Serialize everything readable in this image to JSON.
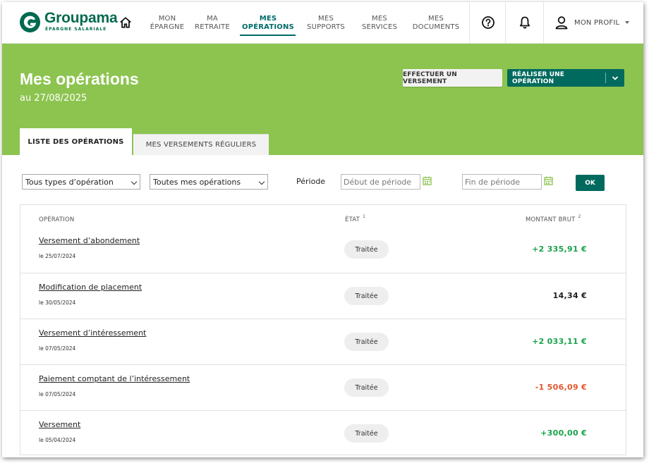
{
  "brand": {
    "name": "Groupama",
    "tagline": "ÉPARGNE SALARIALE",
    "primary_color": "#006a4e",
    "banner_color": "#8cc44f",
    "button_color": "#006a5e",
    "positive_color": "#1aa34a",
    "negative_color": "#e2572b"
  },
  "nav": {
    "items": [
      {
        "line1": "MON",
        "line2": "ÉPARGNE",
        "active": false
      },
      {
        "line1": "MA",
        "line2": "RETRAITE",
        "active": false
      },
      {
        "line1": "MES",
        "line2": "OPÉRATIONS",
        "active": true
      },
      {
        "line1": "MES",
        "line2": "SUPPORTS",
        "active": false
      },
      {
        "line1": "MES",
        "line2": "SERVICES",
        "active": false
      },
      {
        "line1": "MES",
        "line2": "DOCUMENTS",
        "active": false
      }
    ],
    "icons": [
      "home-icon",
      "help-icon",
      "bell-icon",
      "user-icon"
    ],
    "profile_label": "MON PROFIL"
  },
  "banner": {
    "title": "Mes opérations",
    "date": "au 27/08/2025",
    "btn_versement": "EFFECTUER UN VERSEMENT",
    "btn_operation": "RÉALISER UNE OPÉRATION",
    "tabs": [
      "LISTE DES OPÉRATIONS",
      "MES VERSEMENTS RÉGULIERS"
    ]
  },
  "filters": {
    "type_select": "Tous types d’opération",
    "ops_select": "Toutes mes opérations",
    "period_label": "Période",
    "start_placeholder": "Début de période",
    "end_placeholder": "Fin de période",
    "ok_label": "OK"
  },
  "table": {
    "headers": {
      "operation": "OPÉRATION",
      "etat": "ÉTAT",
      "etat_note": "1",
      "montant": "MONTANT BRUT",
      "montant_note": "2"
    },
    "rows": [
      {
        "label": "Versement d’abondement",
        "date": "le 25/07/2024",
        "status": "Traitée",
        "amount": "+2 335,91 €",
        "tone": "positive"
      },
      {
        "label": "Modification de placement",
        "date": "le 30/05/2024",
        "status": "Traitée",
        "amount": "14,34 €",
        "tone": "neutral"
      },
      {
        "label": "Versement d’intéressement",
        "date": "le 07/05/2024",
        "status": "Traitée",
        "amount": "+2 033,11 €",
        "tone": "positive"
      },
      {
        "label": "Paiement comptant de l’intéressement",
        "date": "le 07/05/2024",
        "status": "Traitée",
        "amount": "-1 506,09 €",
        "tone": "negative"
      },
      {
        "label": "Versement",
        "date": "le 05/04/2024",
        "status": "Traitée",
        "amount": "+300,00 €",
        "tone": "positive"
      }
    ]
  }
}
